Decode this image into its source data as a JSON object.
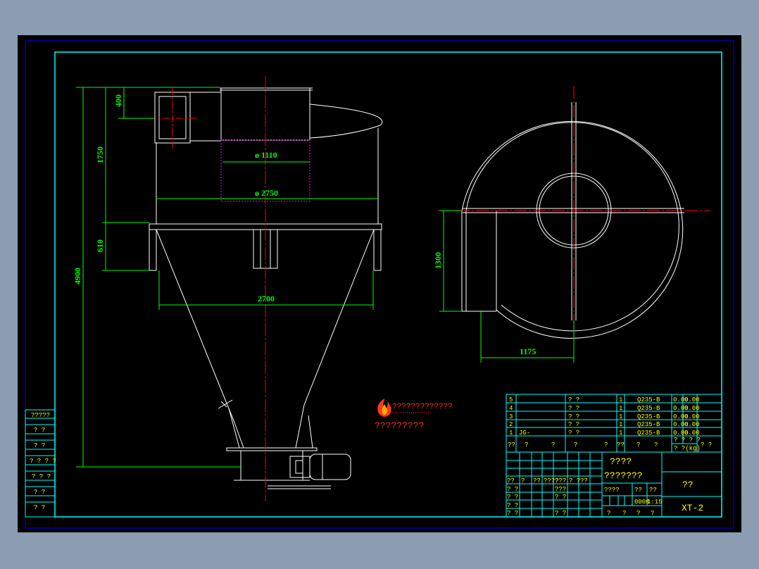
{
  "colors": {
    "background": "#8c9db1",
    "sheet": "#000000",
    "outer_border": "#0000ff",
    "inner_border": "#00ffff",
    "geometry": "#ffffff",
    "dimension": "#00ff00",
    "centerline": "#ff0000",
    "hidden_line": "#ff00ff",
    "text": "#ffff00",
    "logo": "#ff2a2a"
  },
  "dimensions": {
    "d400": "400",
    "d1750": "1750",
    "d610": "610",
    "d4900": "4900",
    "dia1110": "ø 1110",
    "dia2750": "ø 2750",
    "d2700": "2700",
    "d1300": "1300",
    "d1175": "1175"
  },
  "logo": {
    "line1": "?????????????",
    "line2": "?????????"
  },
  "revision_table": {
    "rows": [
      "?????",
      "? ?",
      "? ?",
      "? ? ? ?",
      "? ? ?",
      "? ?",
      "? ?"
    ]
  },
  "title_block": {
    "parts": [
      {
        "no": "5",
        "code": "",
        "name": "? ?",
        "qty": "1",
        "material": "Q235-B",
        "w1": "0.00",
        "w2": "0.00"
      },
      {
        "no": "4",
        "code": "",
        "name": "? ?",
        "qty": "1",
        "material": "Q235-B",
        "w1": "0.00",
        "w2": "0.00"
      },
      {
        "no": "3",
        "code": "",
        "name": "? ?",
        "qty": "1",
        "material": "Q235-B",
        "w1": "0.00",
        "w2": "0.00"
      },
      {
        "no": "2",
        "code": "",
        "name": "? ?",
        "qty": "1",
        "material": "Q235-B",
        "w1": "0.00",
        "w2": "0.00"
      },
      {
        "no": "1",
        "code": "JG-",
        "name": "? ?",
        "qty": "1",
        "material": "Q235-B",
        "w1": "0.00",
        "w2": "0.00"
      }
    ],
    "header": [
      "??",
      "?",
      "?",
      "?",
      "?",
      "??",
      "?",
      "?"
    ],
    "header_weight_top": "? ?  ? ?",
    "header_weight_bottom": "? ?(kg)",
    "header_remark": "? ?",
    "drawing_name_top": "????",
    "drawing_name_bottom": "???????",
    "unit_label": "??",
    "drawing_no": "XT-2",
    "scale_label": "??",
    "scale_value": "1:15",
    "stage_label": "????",
    "weight_label": "??",
    "sheet_label": "0000",
    "signature_rows": [
      [
        "??",
        "?",
        "??",
        "????",
        "???",
        "? ?",
        "??"
      ],
      [
        "? ?",
        "",
        "",
        "",
        "???",
        "",
        ""
      ],
      [
        "? ?",
        "",
        "",
        "",
        "? ?",
        "",
        ""
      ],
      [
        "? ?",
        "",
        "",
        "",
        "",
        "",
        ""
      ],
      [
        "? ?",
        "",
        "",
        "",
        "? ?",
        "",
        ""
      ]
    ],
    "bottom_row": [
      "?",
      "?",
      "?",
      "?"
    ]
  }
}
